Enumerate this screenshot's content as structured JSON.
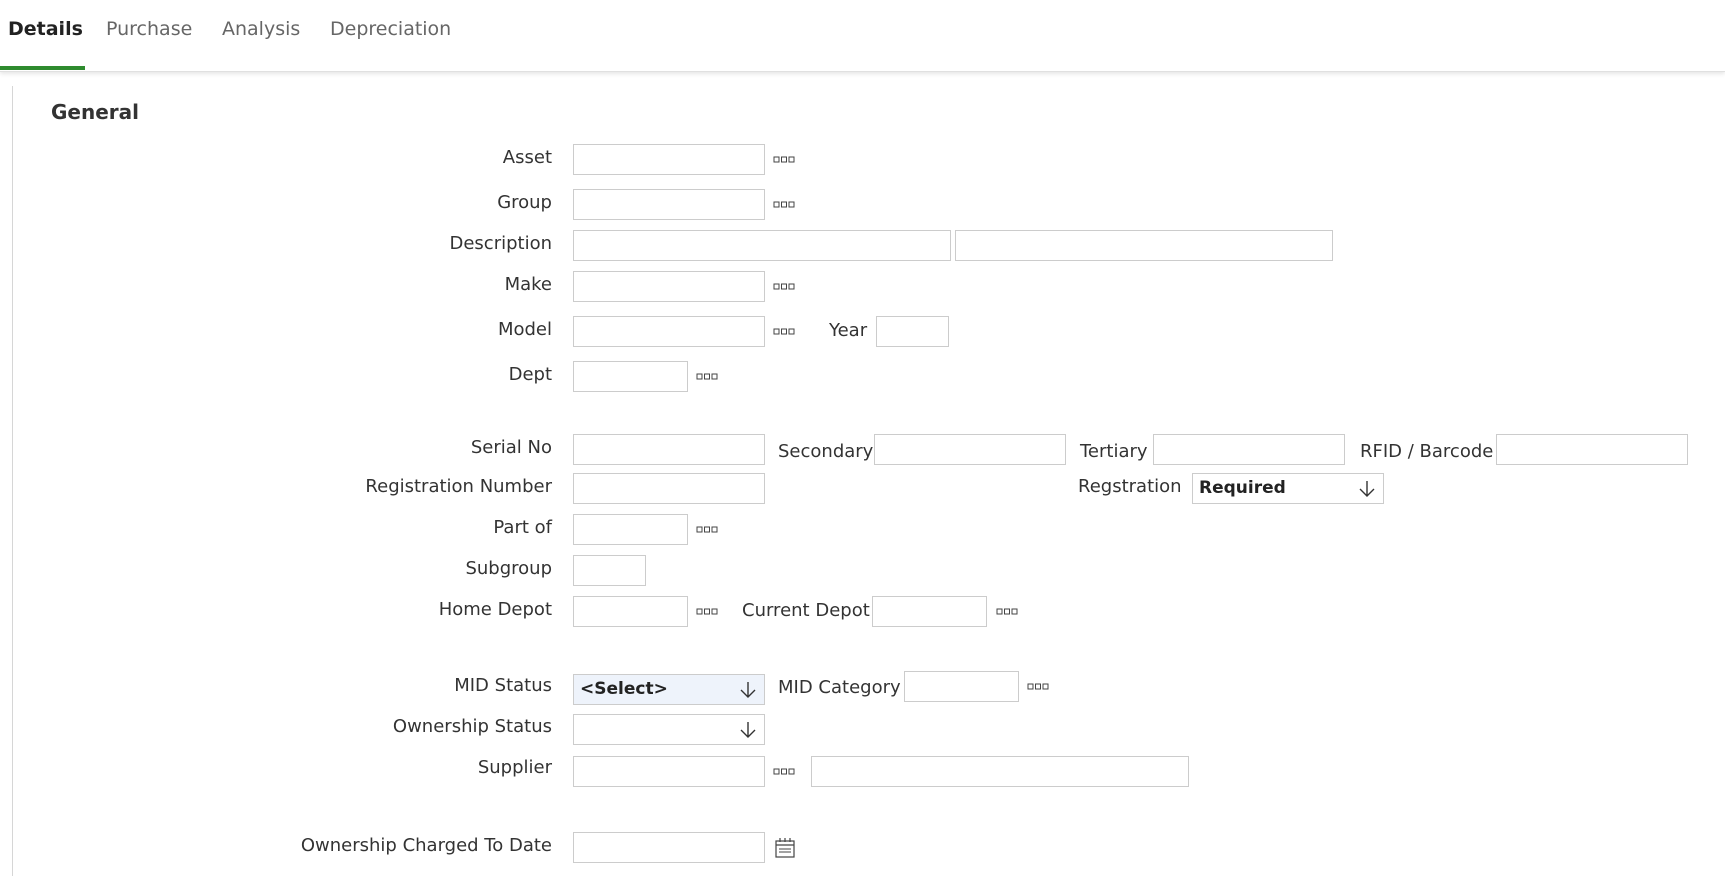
{
  "tabs": [
    {
      "label": "Details"
    },
    {
      "label": "Purchase"
    },
    {
      "label": "Analysis"
    },
    {
      "label": "Depreciation"
    }
  ],
  "section": {
    "title": "General"
  },
  "labels": {
    "asset": "Asset",
    "group": "Group",
    "description": "Description",
    "make": "Make",
    "model": "Model",
    "year": "Year",
    "dept": "Dept",
    "serial_no": "Serial No",
    "secondary": "Secondary",
    "tertiary": "Tertiary",
    "rfid": "RFID / Barcode",
    "registration_number": "Registration Number",
    "regstration": "Regstration",
    "part_of": "Part of",
    "subgroup": "Subgroup",
    "home_depot": "Home Depot",
    "current_depot": "Current Depot",
    "mid_status": "MID Status",
    "mid_category": "MID Category",
    "ownership_status": "Ownership Status",
    "supplier": "Supplier",
    "ownership_charged": "Ownership Charged To Date"
  },
  "selects": {
    "regstration": "Required",
    "mid_status": "<Select>",
    "ownership_status": ""
  },
  "colors": {
    "accent": "#2e8b2e",
    "select_highlight_bg": "#eef3fb"
  },
  "icons": {
    "lookup": "ellipsis-icon",
    "dropdown": "arrow-down-icon",
    "date": "calendar-icon"
  }
}
